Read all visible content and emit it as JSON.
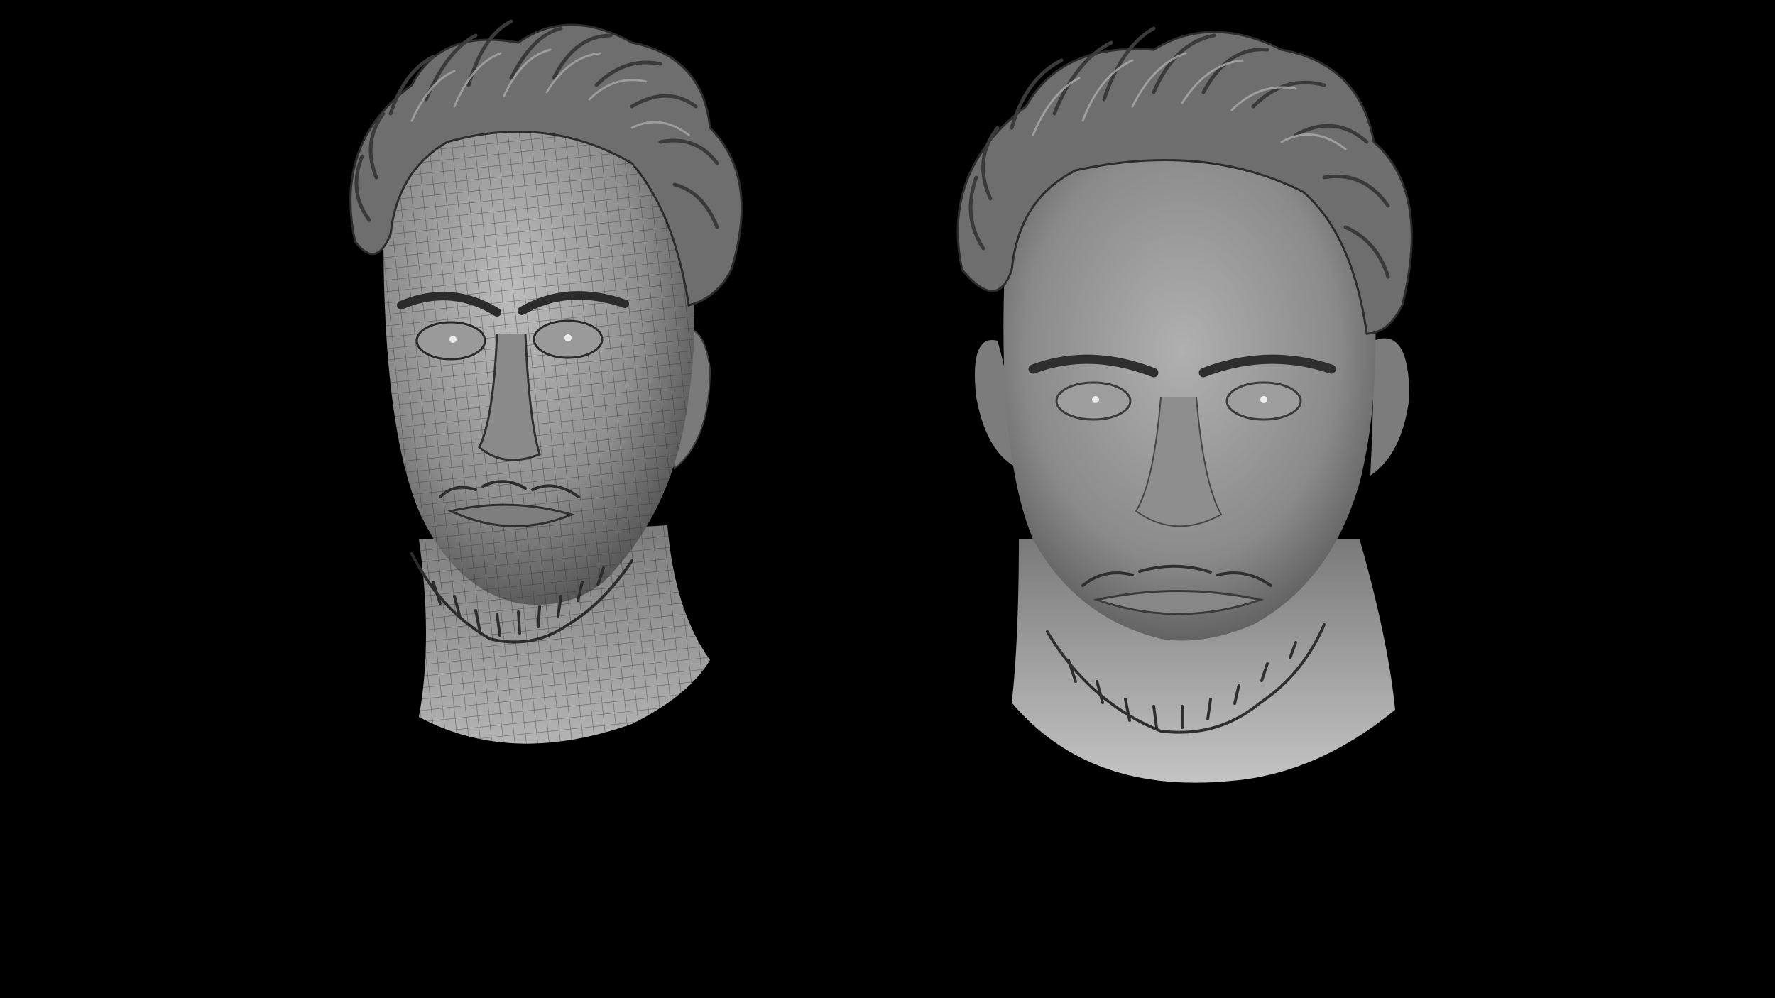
{
  "scene": {
    "background": "#000000",
    "models": [
      {
        "name": "wireframe-head",
        "shading": "quad-topology-wireframe",
        "base_color": "#8c8c8c",
        "line_color": "#3a3a3a"
      },
      {
        "name": "sculpted-head",
        "shading": "smooth-clay",
        "base_color": "#9a9a9a"
      }
    ]
  }
}
